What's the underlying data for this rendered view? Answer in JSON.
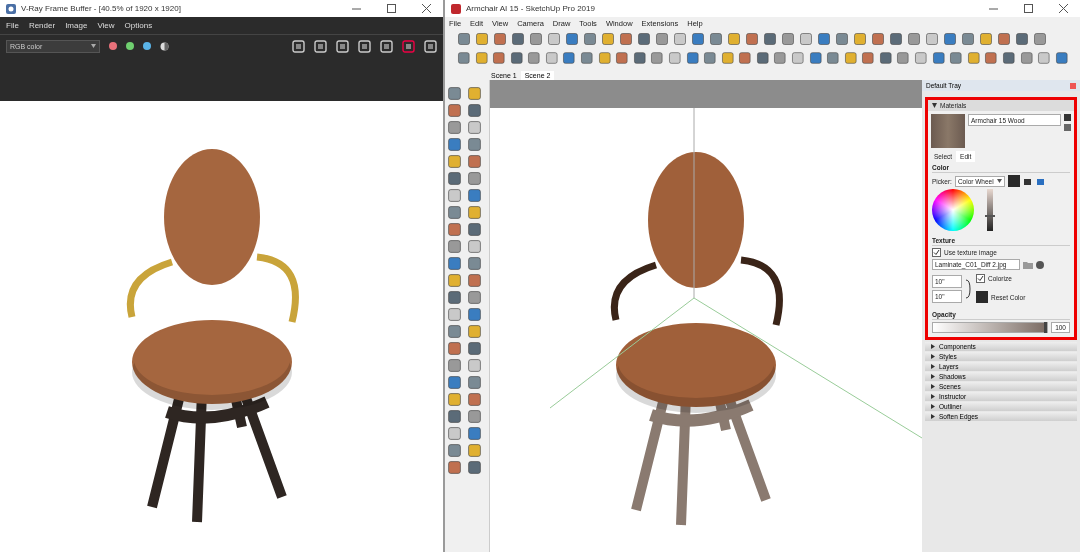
{
  "vfb": {
    "title": "V-Ray Frame Buffer - [40.5% of 1920 x 1920]",
    "menu": [
      "File",
      "Render",
      "Image",
      "View",
      "Options"
    ],
    "channel": "RGB color",
    "channel_dots": [
      {
        "color": "#e8717a"
      },
      {
        "color": "#6fcf6f"
      },
      {
        "color": "#5ab4e8"
      }
    ]
  },
  "sketchup": {
    "title": "Armchair AI 15 - SketchUp Pro 2019",
    "menu": [
      "File",
      "Edit",
      "View",
      "Camera",
      "Draw",
      "Tools",
      "Window",
      "Extensions",
      "Help"
    ],
    "scenes": [
      {
        "label": "Scene 1",
        "selected": false
      },
      {
        "label": "Scene 2",
        "selected": true
      }
    ],
    "tray": {
      "title": "Default Tray",
      "materials": {
        "header": "Materials",
        "name": "Armchair 15 Wood",
        "tabs": [
          {
            "label": "Select",
            "selected": false
          },
          {
            "label": "Edit",
            "selected": true
          }
        ],
        "color_heading": "Color",
        "brightness": {
          "level": 0.35
        },
        "opacity_slider": {
          "level": 1
        },
        "picker_label": "Picker:",
        "picker": "Color Wheel",
        "texture_heading": "Texture",
        "use_texture": {
          "label": "Use texture image",
          "checked": true
        },
        "texture_file": "Laminate_C01_Diff 2.jpg",
        "width": "10\"",
        "height": "10\"",
        "colorize": {
          "label": "Colorize",
          "checked": true
        },
        "reset": "Reset Color",
        "opacity_heading": "Opacity",
        "opacity": "100"
      },
      "panels": [
        {
          "label": "Components",
          "expanded": false
        },
        {
          "label": "Styles",
          "expanded": false
        },
        {
          "label": "Layers",
          "expanded": false
        },
        {
          "label": "Shadows",
          "expanded": false
        },
        {
          "label": "Scenes",
          "expanded": false
        },
        {
          "label": "Instructor",
          "expanded": false
        },
        {
          "label": "Outliner",
          "expanded": false
        },
        {
          "label": "Soften Edges",
          "expanded": false
        }
      ]
    }
  }
}
